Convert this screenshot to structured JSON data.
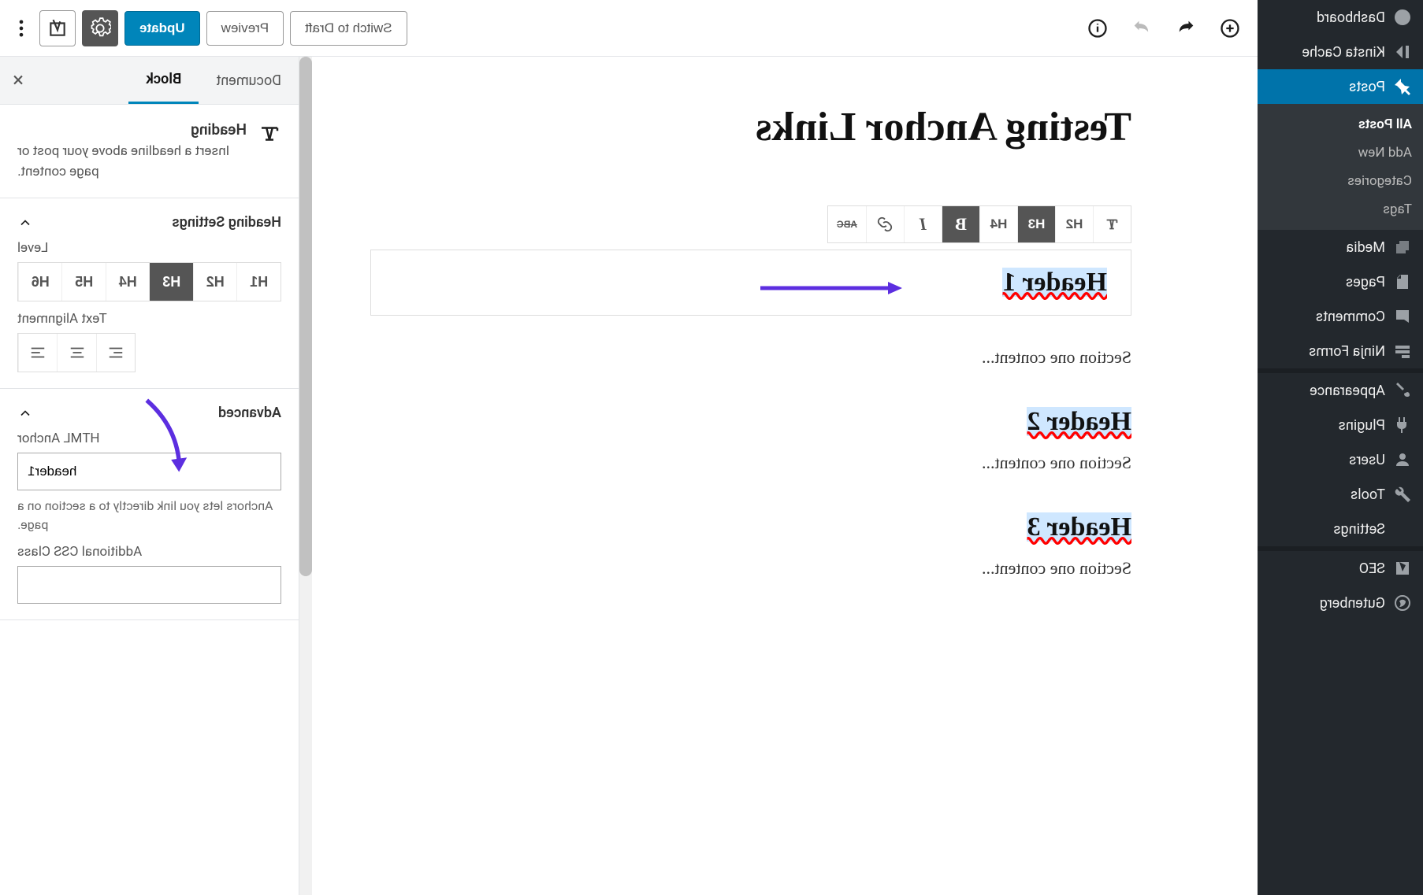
{
  "admin_menu": {
    "dashboard": "Dashboard",
    "kinsta": "Kinsta Cache",
    "posts": "Posts",
    "sub": {
      "all": "All Posts",
      "add": "Add New",
      "cats": "Categories",
      "tags": "Tags"
    },
    "media": "Media",
    "pages": "Pages",
    "comments": "Comments",
    "ninja": "Ninja Forms",
    "appearance": "Appearance",
    "plugins": "Plugins",
    "users": "Users",
    "tools": "Tools",
    "settings": "Settings",
    "seo": "SEO",
    "gutenberg": "Gutenberg"
  },
  "topbar": {
    "draft": "Switch to Draft",
    "preview": "Preview",
    "update": "Update"
  },
  "post": {
    "title": "Testing Anchor Links",
    "h1": "Header 1",
    "p1": "Section one content...",
    "h2": "Header 2",
    "p2": "Section one content...",
    "h3": "Header 3",
    "p3": "Section one content..."
  },
  "block_toolbar": {
    "heading_options": [
      "H2",
      "H3",
      "H4"
    ],
    "selected_heading": "H3",
    "abc": "ABC"
  },
  "inspector": {
    "tabs": {
      "doc": "Document",
      "block": "Block"
    },
    "block_desc": {
      "title": "Heading",
      "sub": "Insert a headline above your post or page content."
    },
    "heading_settings": {
      "title": "Heading Settings",
      "level_label": "Level",
      "levels": [
        "H1",
        "H2",
        "H3",
        "H4",
        "H5",
        "H6"
      ],
      "selected": "H3",
      "align_label": "Text Alignment"
    },
    "advanced": {
      "title": "Advanced",
      "anchor_label": "HTML Anchor",
      "anchor_value": "header1",
      "anchor_help": "Anchors lets you link directly to a section on a page.",
      "css_label": "Additional CSS Class"
    }
  }
}
